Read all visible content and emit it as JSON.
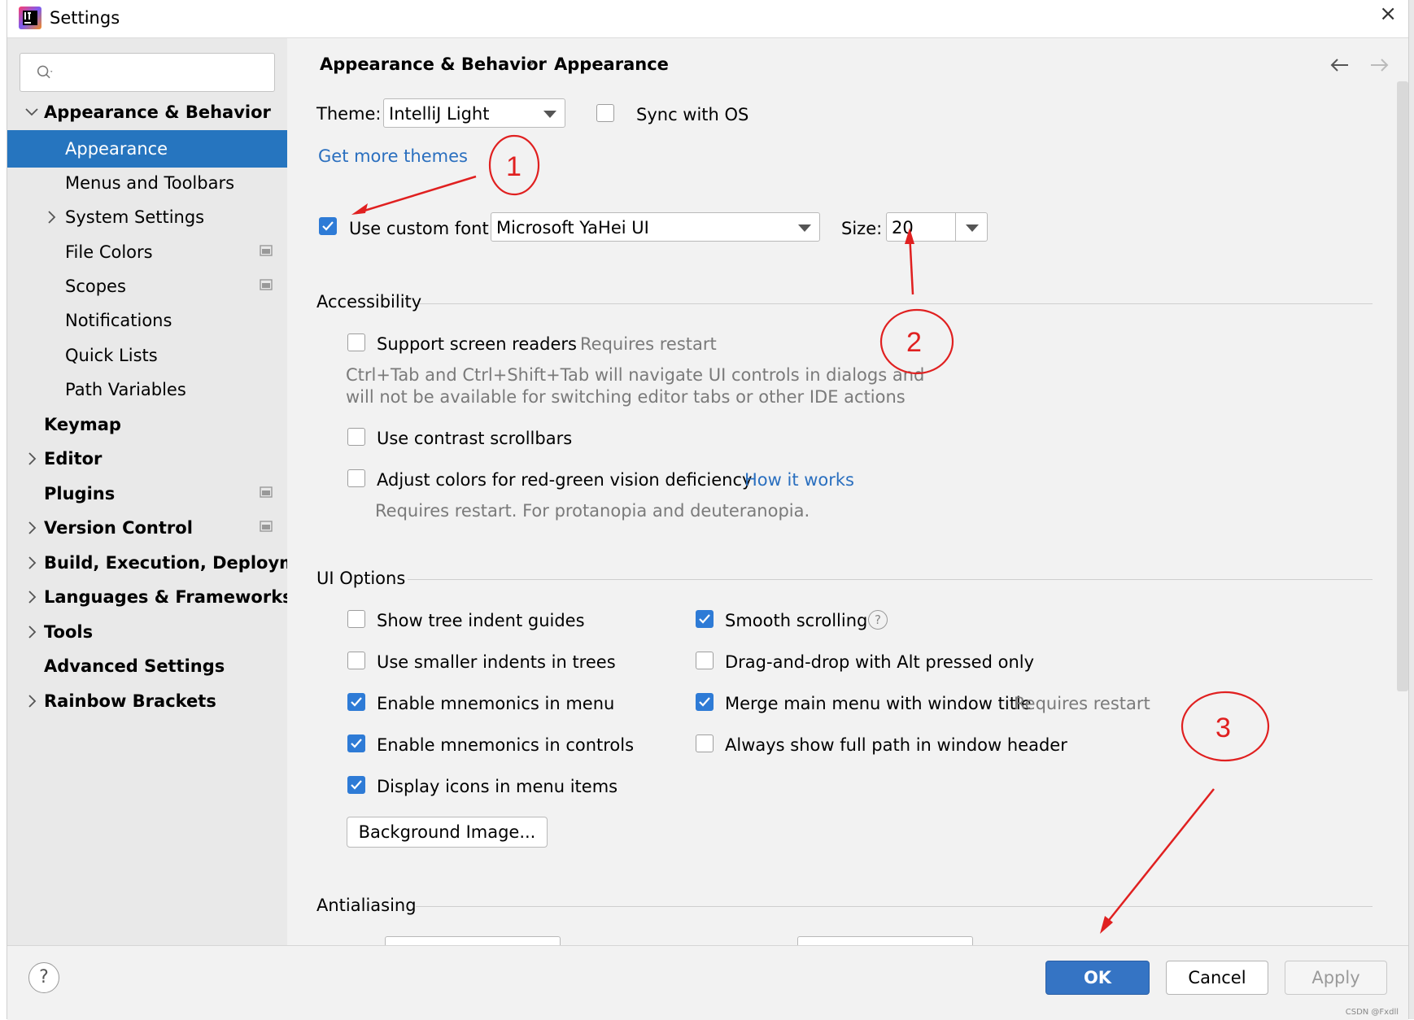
{
  "window": {
    "title": "Settings"
  },
  "sidebar": {
    "search": {
      "placeholder": "",
      "value": ""
    },
    "items": [
      {
        "label": "Appearance & Behavior",
        "bold": true,
        "expanded": true
      },
      {
        "label": "Appearance",
        "selected": true
      },
      {
        "label": "Menus and Toolbars"
      },
      {
        "label": "System Settings",
        "collapsed": true
      },
      {
        "label": "File Colors"
      },
      {
        "label": "Scopes"
      },
      {
        "label": "Notifications"
      },
      {
        "label": "Quick Lists"
      },
      {
        "label": "Path Variables"
      },
      {
        "label": "Keymap",
        "bold": true
      },
      {
        "label": "Editor",
        "bold": true
      },
      {
        "label": "Plugins",
        "bold": true
      },
      {
        "label": "Version Control",
        "bold": true
      },
      {
        "label": "Build, Execution, Deployme",
        "bold": true
      },
      {
        "label": "Languages & Frameworks",
        "bold": true
      },
      {
        "label": "Tools",
        "bold": true
      },
      {
        "label": "Advanced Settings",
        "bold": true
      },
      {
        "label": "Rainbow Brackets",
        "bold": true
      }
    ]
  },
  "breadcrumb": {
    "parent": "Appearance & Behavior",
    "separator": "›",
    "current": "Appearance"
  },
  "theme": {
    "label": "Theme:",
    "value": "IntelliJ Light",
    "sync_label": "Sync with OS",
    "sync_checked": false,
    "more_themes_link": "Get more themes"
  },
  "font": {
    "use_custom_label": "Use custom font:",
    "use_custom_checked": true,
    "family": "Microsoft YaHei UI",
    "size_label": "Size:",
    "size": "20"
  },
  "accessibility": {
    "header": "Accessibility",
    "screen_readers_label": "Support screen readers",
    "screen_readers_note": "Requires restart",
    "screen_readers_desc_1": "Ctrl+Tab and Ctrl+Shift+Tab will navigate UI controls in dialogs and",
    "screen_readers_desc_2": "will not be available for switching editor tabs or other IDE actions",
    "contrast_label": "Use contrast scrollbars",
    "adjust_colors_label": "Adjust colors for red-green vision deficiency",
    "how_it_works": "How it works",
    "adjust_colors_desc": "Requires restart. For protanopia and deuteranopia."
  },
  "ui_options": {
    "header": "UI Options",
    "tree_indent": "Show tree indent guides",
    "smaller_indents": "Use smaller indents in trees",
    "mnemonics_menu": "Enable mnemonics in menu",
    "mnemonics_controls": "Enable mnemonics in controls",
    "display_icons": "Display icons in menu items",
    "smooth_scrolling": "Smooth scrolling",
    "drag_drop": "Drag-and-drop with Alt pressed only",
    "merge_menu": "Merge main menu with window title",
    "merge_menu_note": "Requires restart",
    "full_path": "Always show full path in window header",
    "background_image_button": "Background Image..."
  },
  "antialiasing": {
    "header": "Antialiasing"
  },
  "footer": {
    "ok": "OK",
    "cancel": "Cancel",
    "apply": "Apply",
    "help": "?"
  },
  "annotations": {
    "one": "1",
    "two": "2",
    "three": "3"
  },
  "watermark": "CSDN @Fxdll",
  "colors": {
    "accent": "#2675bf",
    "link": "#2a6fbf",
    "annotation": "#e02020",
    "ok_button": "#3574c4"
  }
}
